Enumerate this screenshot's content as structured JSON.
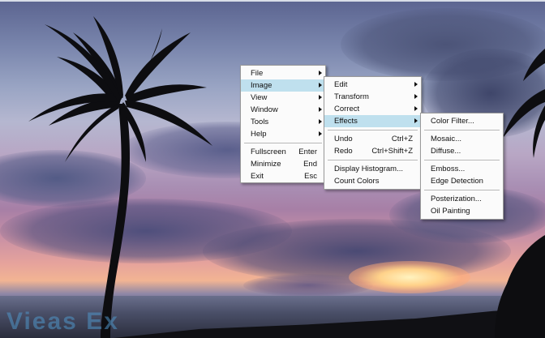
{
  "watermark": "Vieas Ex",
  "main_menu": {
    "items": [
      {
        "label": "File",
        "shortcut": "",
        "submenu": true
      },
      {
        "label": "Image",
        "shortcut": "",
        "submenu": true,
        "highlighted": true
      },
      {
        "label": "View",
        "shortcut": "",
        "submenu": true
      },
      {
        "label": "Window",
        "shortcut": "",
        "submenu": true
      },
      {
        "label": "Tools",
        "shortcut": "",
        "submenu": true
      },
      {
        "label": "Help",
        "shortcut": "",
        "submenu": true
      },
      {
        "label": "Fullscreen",
        "shortcut": "Enter"
      },
      {
        "label": "Minimize",
        "shortcut": "End"
      },
      {
        "label": "Exit",
        "shortcut": "Esc"
      }
    ]
  },
  "image_menu": {
    "items": [
      {
        "label": "Edit",
        "shortcut": "",
        "submenu": true
      },
      {
        "label": "Transform",
        "shortcut": "",
        "submenu": true
      },
      {
        "label": "Correct",
        "shortcut": "",
        "submenu": true
      },
      {
        "label": "Effects",
        "shortcut": "",
        "submenu": true,
        "highlighted": true
      },
      {
        "label": "Undo",
        "shortcut": "Ctrl+Z"
      },
      {
        "label": "Redo",
        "shortcut": "Ctrl+Shift+Z"
      },
      {
        "label": "Display Histogram...",
        "shortcut": ""
      },
      {
        "label": "Count Colors",
        "shortcut": ""
      }
    ]
  },
  "effects_menu": {
    "items": [
      {
        "label": "Color Filter..."
      },
      {
        "label": "Mosaic..."
      },
      {
        "label": "Diffuse..."
      },
      {
        "label": "Emboss..."
      },
      {
        "label": "Edge Detection"
      },
      {
        "label": "Posterization..."
      },
      {
        "label": "Oil Painting"
      }
    ]
  },
  "colors": {
    "menu_bg": "#fbfbfb",
    "highlight": "#bfe0ee",
    "menu_border": "#9a9a9a"
  }
}
